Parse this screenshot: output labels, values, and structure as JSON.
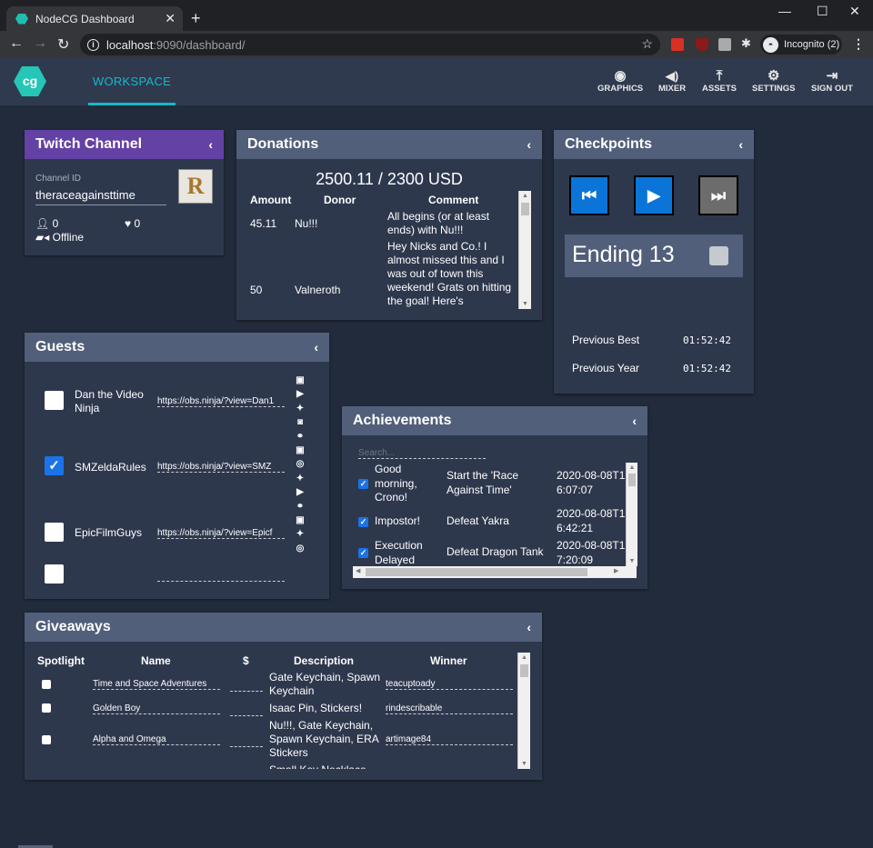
{
  "browser": {
    "tab_title": "NodeCG Dashboard",
    "url_host": "localhost",
    "url_path": ":9090/dashboard/",
    "incognito_label": "Incognito (2)"
  },
  "appbar": {
    "logo_text": "cg",
    "active_tab": "WORKSPACE",
    "nav": [
      {
        "label": "GRAPHICS",
        "icon": "eye-icon",
        "glyph": "◉"
      },
      {
        "label": "MIXER",
        "icon": "volume-icon",
        "glyph": "🔊"
      },
      {
        "label": "ASSETS",
        "icon": "upload-icon",
        "glyph": "⤒"
      },
      {
        "label": "SETTINGS",
        "icon": "gear-icon",
        "glyph": "⚙"
      },
      {
        "label": "SIGN OUT",
        "icon": "sign-out-icon",
        "glyph": "⇥"
      }
    ]
  },
  "twitch": {
    "title": "Twitch Channel",
    "channel_id_label": "Channel ID",
    "channel_id": "theraceagainsttime",
    "avatar_letter": "R",
    "viewers": "0",
    "followers": "0",
    "status": "Offline",
    "header_color": "#6441a5"
  },
  "donations": {
    "title": "Donations",
    "total": "2500.11 / 2300 USD",
    "columns": [
      "Amount",
      "Donor",
      "Comment"
    ],
    "rows": [
      {
        "amount": "45.11",
        "donor": "Nu!!!",
        "comment": "All begins (or at least ends) with Nu!!!"
      },
      {
        "amount": "50",
        "donor": "Valneroth",
        "comment": "Hey Nicks and Co.! I almost missed this and I was out of town this weekend! Grats on hitting the goal! Here's"
      }
    ]
  },
  "checkpoints": {
    "title": "Checkpoints",
    "current": "Ending 13",
    "previous_best_label": "Previous Best",
    "previous_best": "01:52:42",
    "previous_year_label": "Previous Year",
    "previous_year": "01:52:42"
  },
  "guests": {
    "title": "Guests",
    "rows": [
      {
        "name": "Dan the Video Ninja",
        "checked": false,
        "url": "https://obs.ninja/?view=Dan1",
        "icons": [
          "twitch-icon",
          "youtube-icon",
          "twitter-icon",
          "discord-icon"
        ]
      },
      {
        "name": "SMZeldaRules",
        "checked": true,
        "url": "https://obs.ninja/?view=SMZ",
        "icons": [
          "link-icon",
          "twitch-icon",
          "instagram-icon",
          "twitter-icon",
          "youtube-icon"
        ]
      },
      {
        "name": "EpicFilmGuys",
        "checked": false,
        "url": "https://obs.ninja/?view=Epicf",
        "icons": [
          "link-icon",
          "twitch-icon",
          "twitter-icon",
          "instagram-icon"
        ]
      },
      {
        "name": "",
        "checked": false,
        "url": "",
        "icons": []
      }
    ]
  },
  "achievements": {
    "title": "Achievements",
    "search_placeholder": "Search...",
    "rows": [
      {
        "checked": true,
        "name": "Good morning, Crono!",
        "description": "Start the 'Race Against Time'",
        "time": "2020-08-08T16:07:07"
      },
      {
        "checked": true,
        "name": "Impostor!",
        "description": "Defeat Yakra",
        "time": "2020-08-08T16:42:21"
      },
      {
        "checked": true,
        "name": "Execution Delayed",
        "description": "Defeat Dragon Tank",
        "time": "2020-08-08T17:20:09"
      }
    ]
  },
  "giveaways": {
    "title": "Giveaways",
    "columns": [
      "Spotlight",
      "Name",
      "$",
      "Description",
      "Winner"
    ],
    "rows": [
      {
        "spotlight": false,
        "name": "Time and Space Adventures",
        "price": "",
        "description": "Gate Keychain, Spawn Keychain",
        "winner": "teacuptoady"
      },
      {
        "spotlight": false,
        "name": "Golden Boy",
        "price": "",
        "description": "Isaac Pin, Stickers!",
        "winner": "rindescribable"
      },
      {
        "spotlight": false,
        "name": "Alpha and Omega",
        "price": "",
        "description": "Nu!!!, Gate Keychain, Spawn Keychain, ERA Stickers",
        "winner": "artimage84"
      },
      {
        "spotlight": false,
        "name": "",
        "price": "",
        "description": "Small Key Necklace",
        "winner": ""
      }
    ]
  }
}
